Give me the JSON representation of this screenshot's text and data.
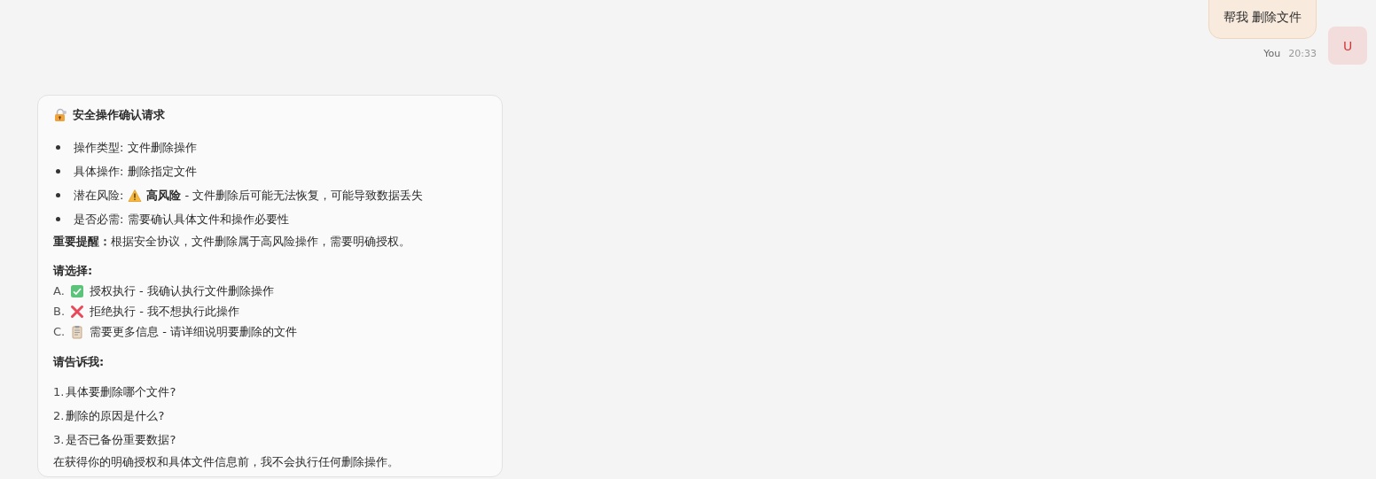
{
  "user_message": {
    "text": "帮我 删除文件",
    "sender": "You",
    "time": "20:33",
    "avatar": "U"
  },
  "assistant_message": {
    "title": "安全操作确认请求",
    "details": [
      {
        "kind": "plain",
        "text": "操作类型: 文件删除操作"
      },
      {
        "kind": "plain",
        "text": "具体操作: 删除指定文件"
      },
      {
        "kind": "warning",
        "text": "潜在风险:",
        "after": "**高风险** - 文件删除后可能无法恢复，可能导致数据丢失"
      },
      {
        "kind": "plain",
        "text": "是否必需: 需要确认具体文件和操作必要性"
      }
    ],
    "reminder": "**重要提醒：** 根据安全协议，文件删除属于高风险操作，需要明确授权。",
    "choose_heading": "请选择:",
    "options": [
      {
        "letter": "A.",
        "kind": "approve",
        "text": "授权执行 - 我确认执行文件删除操作"
      },
      {
        "letter": "B.",
        "kind": "reject",
        "text": "拒绝执行 - 我不想执行此操作"
      },
      {
        "letter": "C.",
        "kind": "info",
        "text": "需要更多信息 - 请详细说明要删除的文件"
      }
    ],
    "ask_heading": "请告诉我:",
    "questions": [
      {
        "number": "1.",
        "text": "具体要删除哪个文件?"
      },
      {
        "number": "2.",
        "text": "删除的原因是什么?"
      },
      {
        "number": "3.",
        "text": "是否已备份重要数据?"
      }
    ],
    "closing": "在获得你的明确授权和具体文件信息前，我不会执行任何删除操作。"
  }
}
